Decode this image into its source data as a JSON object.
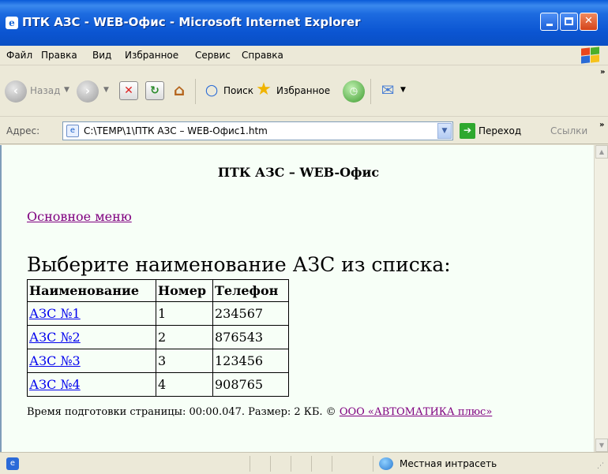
{
  "window": {
    "title": "ПТК АЗС - WEB-Офис - Microsoft Internet Explorer",
    "minimize_label": "",
    "maximize_label": "",
    "close_label": "✕"
  },
  "menu": {
    "items": [
      "Файл",
      "Правка",
      "Вид",
      "Избранное",
      "Сервис",
      "Справка"
    ]
  },
  "toolbar": {
    "back_label": "Назад",
    "search_label": "Поиск",
    "favorites_label": "Избранное",
    "chevron": "»"
  },
  "address": {
    "label": "Адрес:",
    "value": "C:\\TEMP\\1\\ПТК АЗС – WEB-Офис1.htm",
    "go_label": "Переход",
    "links_label": "Ссылки",
    "chevron": "»"
  },
  "page": {
    "heading": "ПТК АЗС – WEB-Офис",
    "main_menu_link": "Основное меню",
    "select_heading": "Выберите наименование АЗС из списка:",
    "table": {
      "headers": [
        "Наименование",
        "Номер",
        "Телефон"
      ],
      "rows": [
        {
          "name": "АЗС №1",
          "number": "1",
          "phone": "234567"
        },
        {
          "name": "АЗС №2",
          "number": "2",
          "phone": "876543"
        },
        {
          "name": "АЗС №3",
          "number": "3",
          "phone": "123456"
        },
        {
          "name": "АЗС №4",
          "number": "4",
          "phone": "908765"
        }
      ]
    },
    "footer_text": "Время подготовки страницы: 00:00.047. Размер: 2 КБ. ©",
    "footer_link": "ООО «АВТОМАТИКА плюс»"
  },
  "status": {
    "zone": "Местная интрасеть"
  },
  "colors": {
    "titlebar": "#0b55d2",
    "content_background": "#f7fff7",
    "visited_link": "#800080",
    "link": "#0000ee"
  }
}
